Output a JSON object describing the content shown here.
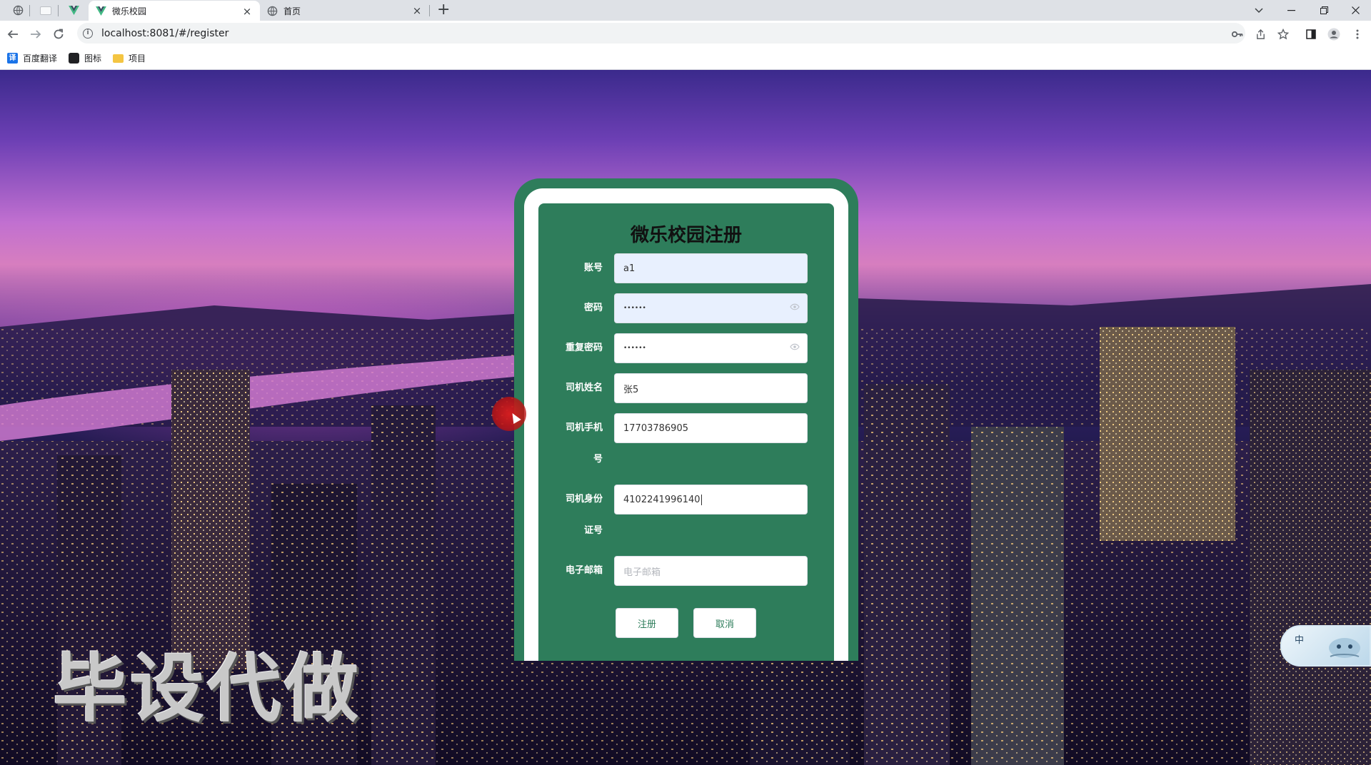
{
  "browser": {
    "tabs": [
      {
        "title": "微乐校园",
        "active": true,
        "favicon": "vue-icon"
      },
      {
        "title": "首页",
        "active": false,
        "favicon": "globe-icon"
      }
    ],
    "close_glyph": "×",
    "new_tab_glyph": "+",
    "address": "localhost:8081/#/register",
    "bookmarks": [
      {
        "label": "百度翻译",
        "icon": "translate-icon",
        "color": "#1a73e8"
      },
      {
        "label": "图标",
        "icon": "image-icon",
        "color": "#202124"
      },
      {
        "label": "项目",
        "icon": "folder-icon",
        "color": "#f4c542"
      }
    ]
  },
  "form": {
    "title": "微乐校园注册",
    "fields": [
      {
        "label": "账号",
        "value": "a1",
        "placeholder": "",
        "type": "text",
        "autofill": true
      },
      {
        "label": "密码",
        "value": "••••••",
        "placeholder": "",
        "type": "password",
        "autofill": true
      },
      {
        "label": "重复密码",
        "value": "••••••",
        "placeholder": "",
        "type": "password",
        "autofill": false
      },
      {
        "label": "司机姓名",
        "value": "张5",
        "placeholder": "",
        "type": "text",
        "autofill": false
      },
      {
        "label_line1": "司机手机",
        "label_line2": "号",
        "value": "17703786905",
        "placeholder": "",
        "type": "text",
        "autofill": false
      },
      {
        "label_line1": "司机身份",
        "label_line2": "证号",
        "value": "4102241996140",
        "placeholder": "",
        "type": "text",
        "autofill": false
      },
      {
        "label": "电子邮箱",
        "value": "",
        "placeholder": "电子邮箱",
        "type": "text",
        "autofill": false
      }
    ],
    "submit_label": "注册",
    "cancel_label": "取消"
  },
  "overlay": {
    "watermark": "毕设代做",
    "ime_label": "中"
  },
  "colors": {
    "card_green": "#2e7d5b",
    "autofill_blue": "#e8f0fe"
  }
}
